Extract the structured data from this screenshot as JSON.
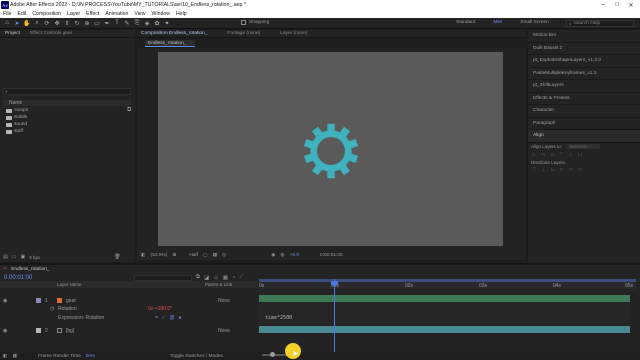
{
  "app": {
    "window_title": "Adobe After Effects 2022 - D:\\IN PROCESS\\YouTube\\MY_TUTORIALS\\ae\\10_Endless_rotation_.aep *",
    "logo_text": "Ae"
  },
  "menu": [
    "File",
    "Edit",
    "Composition",
    "Layer",
    "Effect",
    "Animation",
    "View",
    "Window",
    "Help"
  ],
  "toolbar": {
    "snapping_label": "Snapping",
    "workspaces": [
      "Standard",
      "Mini",
      "Small Screen"
    ],
    "active_workspace": "Mini",
    "search_placeholder": "Search Help"
  },
  "project_panel": {
    "tabs": [
      "Project",
      "Effect Controls gear"
    ],
    "search_placeholder": "",
    "column_name": "Name",
    "folders": [
      "comps",
      "Solids",
      "sound",
      "stuff"
    ],
    "bpc": "8 bpc"
  },
  "comp_panel": {
    "tabs": [
      "Composition Endless_rotation_",
      "Footage (none)",
      "Layer (none)"
    ],
    "subtab": "Endless_rotation_",
    "zoom": "(53.9%)",
    "resolution": "Half",
    "timecode": "0:00:01:00",
    "exposure": "+0.0",
    "gear_color": "#3fb2bd",
    "bg_color": "#5a5a5a"
  },
  "right_panel": {
    "items": [
      "Motion Bro",
      "Duik Bassel.2",
      "pt_ExplodeShapeLayers_v1.3.0",
      "PasteMultipleKeyframes_v1.3",
      "pt_ShiftLayers",
      "Effects & Presets",
      "Character",
      "Paragraph"
    ],
    "align_title": "Align",
    "align_layers_to": "Align Layers to:",
    "align_layers_to_value": "Selection",
    "distribute_layers": "Distribute Layers:"
  },
  "timeline": {
    "comp_tab": "Endless_rotation_",
    "current_time": "0:00:01:00",
    "fps_hint": "00025 (25.00 fps)",
    "column_name": "Layer Name",
    "column_parent": "Parent & Link",
    "ruler_labels": [
      "0s",
      "01s",
      "02s",
      "03s",
      "04s",
      "05s"
    ],
    "layers": [
      {
        "index": "1",
        "name": "gear",
        "parent": "None"
      },
      {
        "index": "2",
        "name": "[bg]",
        "parent": "None"
      }
    ],
    "rotation_label": "Rotation",
    "rotation_value": "0x +180.0°",
    "expression_label": "Expression: Rotation",
    "expression_text": "time*2500",
    "frame_render_label": "Frame Render Time",
    "frame_render_value": "0ms",
    "toggle_label": "Toggle Switches / Modes"
  }
}
